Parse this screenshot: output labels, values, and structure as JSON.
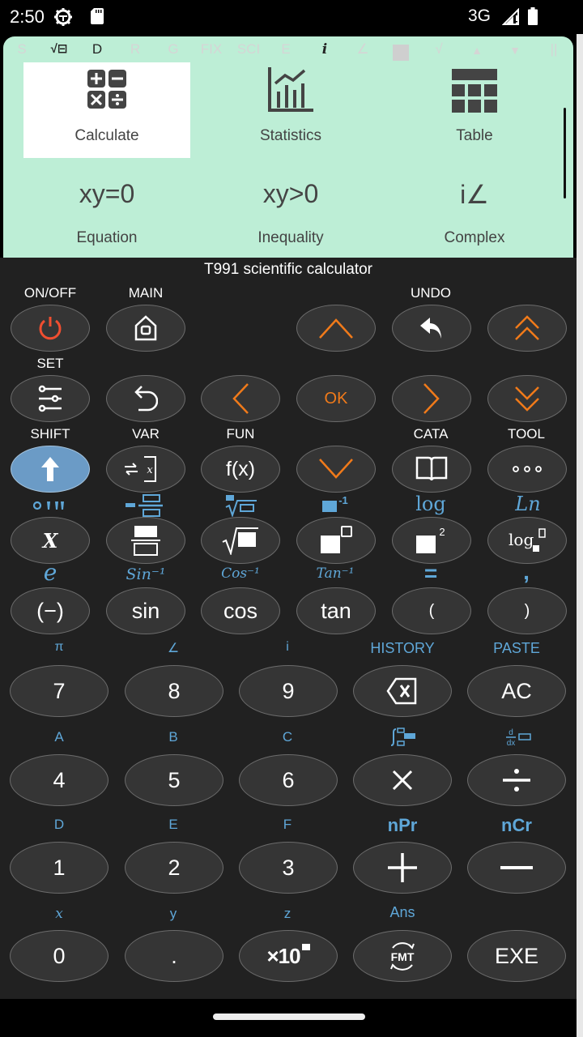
{
  "status_bar": {
    "time": "2:50",
    "icons": [
      "gear-icon",
      "sd-card-icon"
    ],
    "network": "3G",
    "signal_icon": "signal-no-data-icon",
    "battery_icon": "battery-full-icon"
  },
  "display": {
    "indicators": [
      {
        "label": "S",
        "active": false
      },
      {
        "label": "√⊟",
        "active": true
      },
      {
        "label": "D",
        "active": true
      },
      {
        "label": "R",
        "active": false
      },
      {
        "label": "G",
        "active": false
      },
      {
        "label": "FIX",
        "active": false
      },
      {
        "label": "SCI",
        "active": false
      },
      {
        "label": "E",
        "active": false
      },
      {
        "label": "i",
        "active": true
      },
      {
        "label": "∠",
        "active": false
      },
      {
        "label": "■",
        "active": false
      },
      {
        "label": "√",
        "active": false
      },
      {
        "label": "▲",
        "active": false
      },
      {
        "label": "▼",
        "active": false
      },
      {
        "label": "||",
        "active": false
      }
    ],
    "menu": [
      {
        "label": "Calculate",
        "icon": "calculator-icon",
        "active": true
      },
      {
        "label": "Statistics",
        "icon": "statistics-chart-icon",
        "active": false
      },
      {
        "label": "Table",
        "icon": "table-icon",
        "active": false
      },
      {
        "label": "Equation",
        "glyph": "xy=0",
        "active": false
      },
      {
        "label": "Inequality",
        "glyph": "xy>0",
        "active": false
      },
      {
        "label": "Complex",
        "glyph": "i∠",
        "active": false
      }
    ]
  },
  "keypad": {
    "title": "T991 scientific calculator",
    "row1": {
      "labels": [
        "ON/OFF",
        "MAIN",
        "UNDO"
      ],
      "keys": [
        "power-icon",
        "home-icon",
        "up-arrow-icon",
        "undo-icon",
        "double-up-icon"
      ]
    },
    "row2": {
      "labels": [
        "SET"
      ],
      "keys": [
        "settings-sliders-icon",
        "back-icon",
        "left-arrow-icon",
        "OK",
        "right-arrow-icon",
        "double-down-icon"
      ],
      "ok_label": "OK"
    },
    "row3": {
      "labels": [
        "SHIFT",
        "VAR",
        "FUN",
        "CATA",
        "TOOL"
      ],
      "keys": [
        "shift-arrow-icon",
        "variable-icon",
        "f(x)",
        "down-arrow-icon",
        "catalog-book-icon",
        "more-dots-icon"
      ],
      "fun_label": "f(x)"
    },
    "row4": {
      "shift_labels": [
        "°'\"",
        "mixed-fraction",
        "nth-root",
        "inverse",
        "log",
        "Ln"
      ],
      "keys": [
        "X",
        "fraction-icon",
        "square-root-icon",
        "power-icon-box",
        "square-icon",
        "log-base-icon"
      ],
      "x_label": "X",
      "log_shift": "log",
      "ln_shift": "Ln"
    },
    "row5": {
      "shift_labels": [
        "e",
        "Sin⁻¹",
        "Cos⁻¹",
        "Tan⁻¹",
        "=",
        ","
      ],
      "keys": [
        "(−)",
        "sin",
        "cos",
        "tan",
        "(",
        ")"
      ]
    },
    "row6": {
      "shift_labels": [
        "π",
        "∠",
        "i",
        "HISTORY",
        "PASTE"
      ],
      "keys": [
        "7",
        "8",
        "9",
        "backspace-icon",
        "AC"
      ]
    },
    "row7": {
      "shift_labels": [
        "A",
        "B",
        "C",
        "integral-icon",
        "derivative-icon"
      ],
      "keys": [
        "4",
        "5",
        "6",
        "×",
        "÷"
      ]
    },
    "row8": {
      "shift_labels": [
        "D",
        "E",
        "F",
        "nPr",
        "nCr"
      ],
      "keys": [
        "1",
        "2",
        "3",
        "+",
        "−"
      ]
    },
    "row9": {
      "shift_labels": [
        "x",
        "y",
        "z",
        "Ans"
      ],
      "keys": [
        "0",
        ".",
        "×10",
        "FMT",
        "EXE"
      ]
    }
  },
  "colors": {
    "display_bg": "#bdeed6",
    "keypad_bg": "#212121",
    "key_bg": "#353535",
    "shift_key": "#6b9bc6",
    "shift_label": "#5fa7d8",
    "nav_arrow": "#f07a1a",
    "power": "#f04e30"
  }
}
